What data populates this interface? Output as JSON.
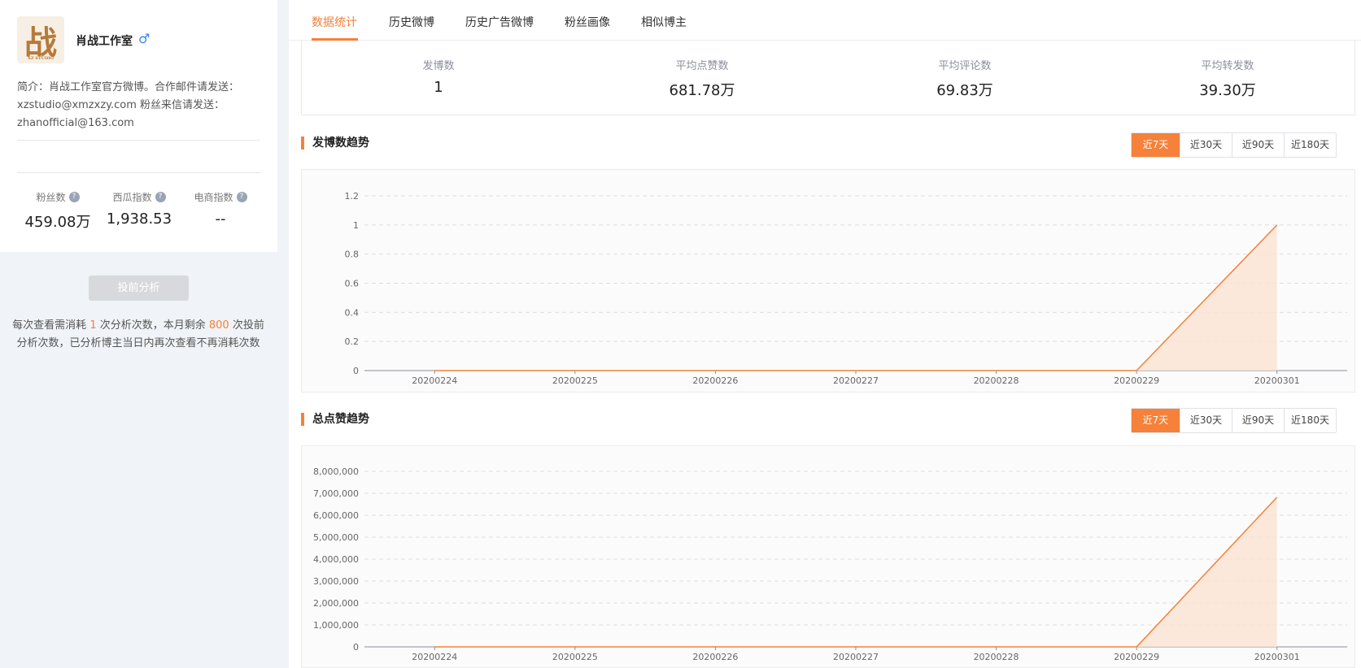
{
  "profile": {
    "avatar_char": "战",
    "avatar_sub": "XZ STUDIO",
    "name": "肖战工作室",
    "gender_icon": "♂",
    "intro": "简介：肖战工作室官方微博。合作邮件请发送：xzstudio@xmzxzy.com 粉丝来信请发送：zhanofficial@163.com"
  },
  "side_stats": [
    {
      "label": "粉丝数",
      "value": "459.08万"
    },
    {
      "label": "西瓜指数",
      "value": "1,938.53"
    },
    {
      "label": "电商指数",
      "value": "--"
    }
  ],
  "analyze_button": "投前分析",
  "notice": {
    "part1": "每次查看需消耗 ",
    "cost": "1",
    "part2": " 次分析次数，本月剩余 ",
    "remaining": "800",
    "part3": " 次投前分析次数，已分析博主当日内再次查看不再消耗次数"
  },
  "tabs": [
    "数据统计",
    "历史微博",
    "历史广告微博",
    "粉丝画像",
    "相似博主"
  ],
  "active_tab": "数据统计",
  "summary": [
    {
      "label": "发博数",
      "value": "1"
    },
    {
      "label": "平均点赞数",
      "value": "681.78万"
    },
    {
      "label": "平均评论数",
      "value": "69.83万"
    },
    {
      "label": "平均转发数",
      "value": "39.30万"
    }
  ],
  "range_options": [
    "近7天",
    "近30天",
    "近90天",
    "近180天"
  ],
  "colors": {
    "accent": "#f5813a",
    "fill": "#fde3d3"
  },
  "chart_data": [
    {
      "type": "area",
      "title": "发博数趋势",
      "x": [
        "20200224",
        "20200225",
        "20200226",
        "20200227",
        "20200228",
        "20200229",
        "20200301"
      ],
      "values": [
        0,
        0,
        0,
        0,
        0,
        0,
        1
      ],
      "yticks": [
        "0",
        "0.2",
        "0.4",
        "0.6",
        "0.8",
        "1",
        "1.2"
      ],
      "ylim": [
        0,
        1.2
      ],
      "grid": true
    },
    {
      "type": "area",
      "title": "总点赞趋势",
      "x": [
        "20200224",
        "20200225",
        "20200226",
        "20200227",
        "20200228",
        "20200229",
        "20200301"
      ],
      "values": [
        0,
        0,
        0,
        0,
        0,
        0,
        6817800
      ],
      "yticks": [
        "0",
        "1,000,000",
        "2,000,000",
        "3,000,000",
        "4,000,000",
        "5,000,000",
        "6,000,000",
        "7,000,000",
        "8,000,000"
      ],
      "ylim": [
        0,
        8000000
      ],
      "grid": true
    }
  ]
}
